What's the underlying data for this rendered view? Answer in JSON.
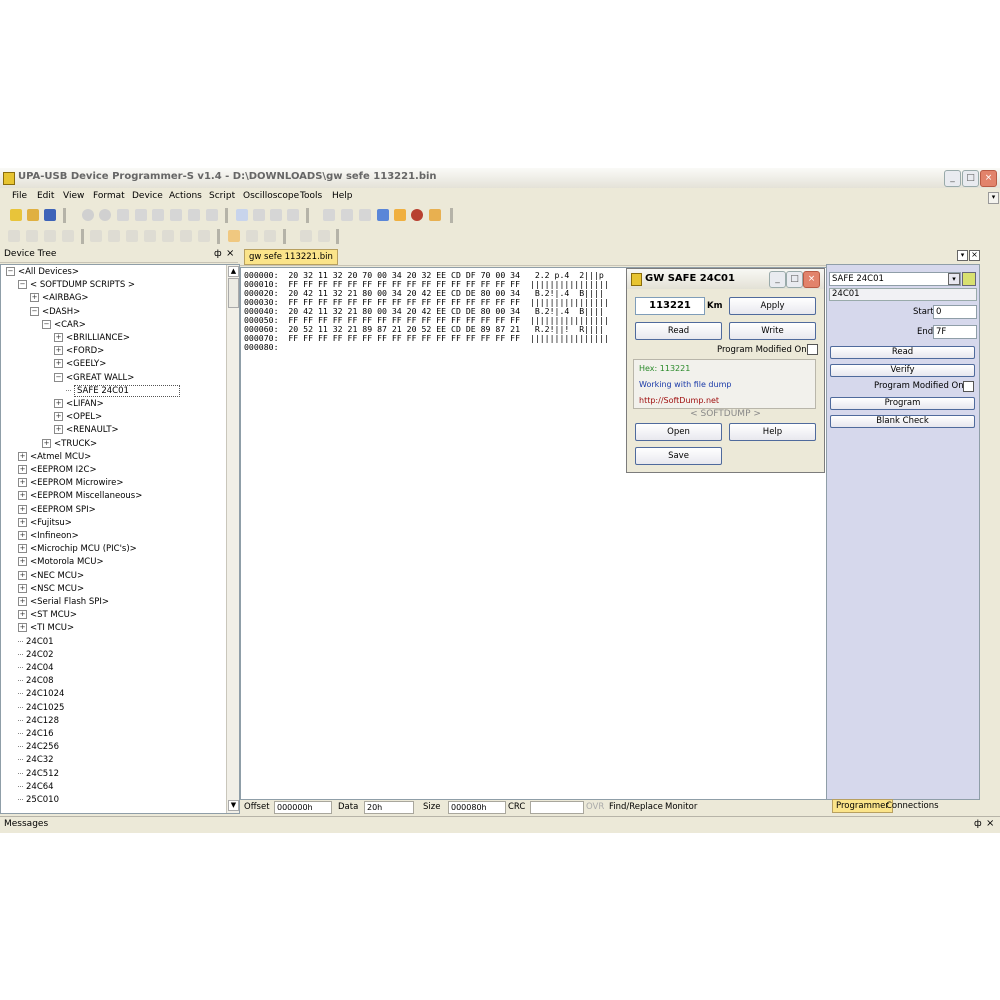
{
  "window": {
    "title": "UPA-USB Device Programmer-S v1.4 - D:\\DOWNLOADS\\gw sefe 113221.bin",
    "controls": [
      "_",
      "□",
      "×"
    ]
  },
  "menu": [
    "File",
    "Edit",
    "View",
    "Format",
    "Device",
    "Actions",
    "Script",
    "Oscilloscope",
    "Tools",
    "Help"
  ],
  "device_tree": {
    "header": "Device Tree",
    "pin_icon": "ф",
    "close_icon": "×",
    "items": [
      {
        "label": "<All Devices>",
        "level": 0,
        "expander": "−"
      },
      {
        "label": "< SOFTDUMP SCRIPTS >",
        "level": 1,
        "expander": "−"
      },
      {
        "label": "<AIRBAG>",
        "level": 2,
        "expander": "+"
      },
      {
        "label": "<DASH>",
        "level": 2,
        "expander": "−"
      },
      {
        "label": "<CAR>",
        "level": 3,
        "expander": "−"
      },
      {
        "label": "<BRILLIANCE>",
        "level": 4,
        "expander": "+"
      },
      {
        "label": "<FORD>",
        "level": 4,
        "expander": "+"
      },
      {
        "label": "<GEELY>",
        "level": 4,
        "expander": "+"
      },
      {
        "label": "<GREAT WALL>",
        "level": 4,
        "expander": "−"
      },
      {
        "label": "SAFE 24C01",
        "level": 5,
        "expander": "",
        "selected": true
      },
      {
        "label": "<LIFAN>",
        "level": 4,
        "expander": "+"
      },
      {
        "label": "<OPEL>",
        "level": 4,
        "expander": "+"
      },
      {
        "label": "<RENAULT>",
        "level": 4,
        "expander": "+"
      },
      {
        "label": "<TRUCK>",
        "level": 3,
        "expander": "+"
      },
      {
        "label": "<Atmel MCU>",
        "level": 1,
        "expander": "+"
      },
      {
        "label": "<EEPROM I2C>",
        "level": 1,
        "expander": "+"
      },
      {
        "label": "<EEPROM Microwire>",
        "level": 1,
        "expander": "+"
      },
      {
        "label": "<EEPROM Miscellaneous>",
        "level": 1,
        "expander": "+"
      },
      {
        "label": "<EEPROM SPI>",
        "level": 1,
        "expander": "+"
      },
      {
        "label": "<Fujitsu>",
        "level": 1,
        "expander": "+"
      },
      {
        "label": "<Infineon>",
        "level": 1,
        "expander": "+"
      },
      {
        "label": "<Microchip MCU (PIC's)>",
        "level": 1,
        "expander": "+"
      },
      {
        "label": "<Motorola MCU>",
        "level": 1,
        "expander": "+"
      },
      {
        "label": "<NEC MCU>",
        "level": 1,
        "expander": "+"
      },
      {
        "label": "<NSC MCU>",
        "level": 1,
        "expander": "+"
      },
      {
        "label": "<Serial Flash SPI>",
        "level": 1,
        "expander": "+"
      },
      {
        "label": "<ST MCU>",
        "level": 1,
        "expander": "+"
      },
      {
        "label": "<TI MCU>",
        "level": 1,
        "expander": "+"
      },
      {
        "label": "24C01",
        "level": 1,
        "expander": ""
      },
      {
        "label": "24C02",
        "level": 1,
        "expander": ""
      },
      {
        "label": "24C04",
        "level": 1,
        "expander": ""
      },
      {
        "label": "24C08",
        "level": 1,
        "expander": ""
      },
      {
        "label": "24C1024",
        "level": 1,
        "expander": ""
      },
      {
        "label": "24C1025",
        "level": 1,
        "expander": ""
      },
      {
        "label": "24C128",
        "level": 1,
        "expander": ""
      },
      {
        "label": "24C16",
        "level": 1,
        "expander": ""
      },
      {
        "label": "24C256",
        "level": 1,
        "expander": ""
      },
      {
        "label": "24C32",
        "level": 1,
        "expander": ""
      },
      {
        "label": "24C512",
        "level": 1,
        "expander": ""
      },
      {
        "label": "24C64",
        "level": 1,
        "expander": ""
      },
      {
        "label": "25C010",
        "level": 1,
        "expander": ""
      }
    ]
  },
  "editor": {
    "tab_label": "gw sefe 113221.bin",
    "hex_lines": [
      "000000:  20 32 11 32 20 70 00 34 20 32 EE CD DF 70 00 34   2.2 p.4  2|||p",
      "000010:  FF FF FF FF FF FF FF FF FF FF FF FF FF FF FF FF  ||||||||||||||||",
      "000020:  20 42 11 32 21 80 00 34 20 42 EE CD DE 80 00 34   B.2!|.4  B||||",
      "000030:  FF FF FF FF FF FF FF FF FF FF FF FF FF FF FF FF  ||||||||||||||||",
      "000040:  20 42 11 32 21 80 00 34 20 42 EE CD DE 80 00 34   B.2!|.4  B||||",
      "000050:  FF FF FF FF FF FF FF FF FF FF FF FF FF FF FF FF  ||||||||||||||||",
      "000060:  20 52 11 32 21 89 87 21 20 52 EE CD DE 89 87 21   R.2!||!  R||||",
      "000070:  FF FF FF FF FF FF FF FF FF FF FF FF FF FF FF FF  ||||||||||||||||",
      "000080:"
    ]
  },
  "statusbar": {
    "offset_label": "Offset",
    "offset_value": "000000h",
    "data_label": "Data",
    "data_value": "20h",
    "size_label": "Size",
    "size_value": "000080h",
    "crc_label": "CRC",
    "crc_value": "",
    "ovr_label": "OVR",
    "find_label": "Find/Replace",
    "monitor_label": "Monitor"
  },
  "dialog": {
    "title": "GW SAFE 24C01",
    "km_value": "113221",
    "km_label": "Km",
    "apply": "Apply",
    "read": "Read",
    "write": "Write",
    "modified_label": "Program Modified Only",
    "info_hex": "Hex: 113221",
    "info_status": "Working with file dump",
    "info_url": "http://SoftDump.net",
    "brand": "< SOFTDUMP >",
    "open": "Open",
    "help": "Help",
    "save": "Save",
    "colors": {
      "hex": "#2a8a2a",
      "status": "#1a3aa8",
      "url": "#a01010"
    }
  },
  "right_panel": {
    "device_select": "SAFE 24C01",
    "device_name": "24C01",
    "start_label": "Start",
    "start_value": "0",
    "end_label": "End",
    "end_value": "7F",
    "read": "Read",
    "verify": "Verify",
    "modified_label": "Program Modified Only",
    "program": "Program",
    "blank_check": "Blank Check",
    "tabs": [
      "Programmer",
      "Connections"
    ]
  },
  "messages": {
    "label": "Messages"
  }
}
